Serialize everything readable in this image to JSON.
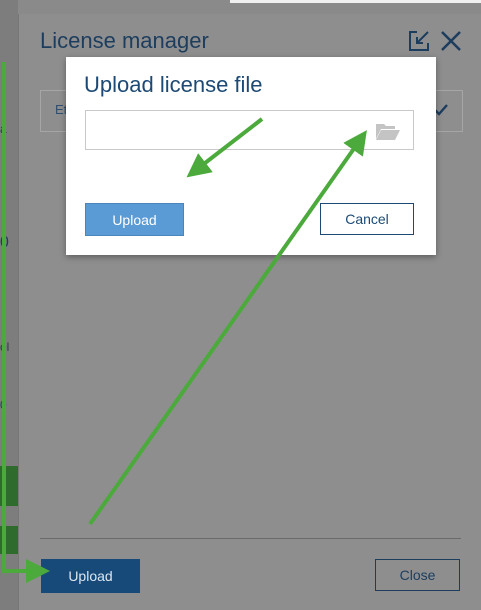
{
  "license_manager": {
    "title": "License manager",
    "field_text": "Et",
    "upload_label": "Upload",
    "close_label": "Close",
    "left_fragments": [
      "a",
      "0",
      "ol",
      "0"
    ]
  },
  "upload_dialog": {
    "title": "Upload license file",
    "input_value": "",
    "upload_label": "Upload",
    "cancel_label": "Cancel"
  },
  "colors": {
    "accent": "#174a79",
    "upload_active": "#5b9bd5",
    "annotation_green": "#4caa3c"
  },
  "icons": [
    "popout-icon",
    "close-icon",
    "checkmark-icon",
    "folder-open-icon"
  ]
}
